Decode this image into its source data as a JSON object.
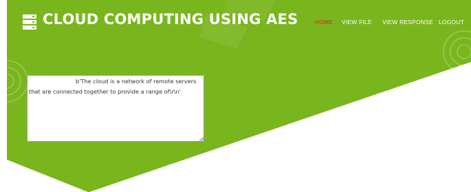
{
  "app": {
    "title": "CLOUD COMPUTING USING AES",
    "logo_icon": "server-stack-icon"
  },
  "nav": {
    "items": [
      {
        "label": "HOME",
        "active": true
      },
      {
        "label": "VIEW FILE",
        "active": false
      },
      {
        "label": "VIEW RESPONSE",
        "active": false
      },
      {
        "label": "LOGOUT",
        "active": false
      }
    ]
  },
  "content": {
    "textarea_value": "b'The cloud is a network of remote servers that are connected together to provide a range of\\r\\n'"
  },
  "colors": {
    "accent_green": "#79b61e",
    "active_nav": "#d42b1e",
    "background": "#ffffff"
  }
}
